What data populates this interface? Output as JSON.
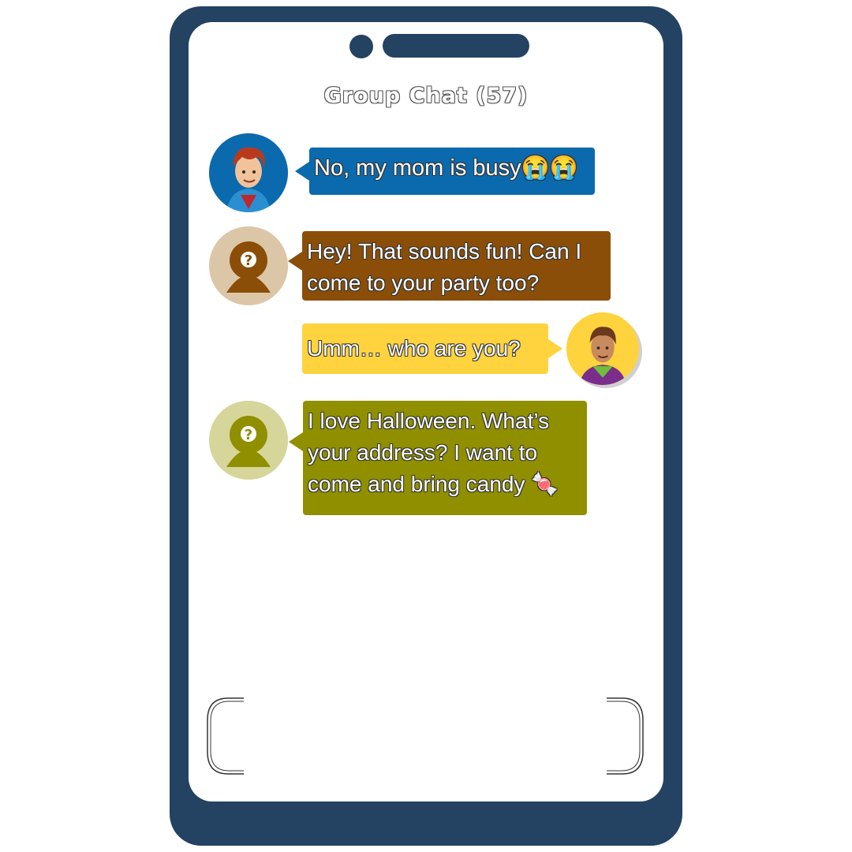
{
  "chat": {
    "title": "Group Chat (57)",
    "messages": [
      {
        "sender": "Boy in blue hoodie",
        "text": "No, my mom is busy😭😭",
        "color": "#0a6aad",
        "avatar_bg": "#0a6aad",
        "avatar_icon": "boy-red-hair-avatar"
      },
      {
        "sender": "Unknown",
        "text": "Hey! That sounds fun! Can I come to your party too?",
        "color": "#8a4e08",
        "avatar_bg": "#dcc6a8",
        "avatar_icon": "unknown-user-avatar"
      },
      {
        "sender": "Teen in purple jacket",
        "text": "Umm… who are you?",
        "color": "#ffd33d",
        "avatar_bg": "#ffd33d",
        "avatar_icon": "boy-brown-hair-avatar"
      },
      {
        "sender": "Unknown",
        "text": "I love Halloween. What’s your address? I want to come and bring candy 🍬",
        "color": "#8f8f00",
        "avatar_bg": "#d6d69a",
        "avatar_icon": "unknown-user-avatar"
      }
    ]
  },
  "colors": {
    "frame": "#244261",
    "screen": "#ffffff"
  }
}
